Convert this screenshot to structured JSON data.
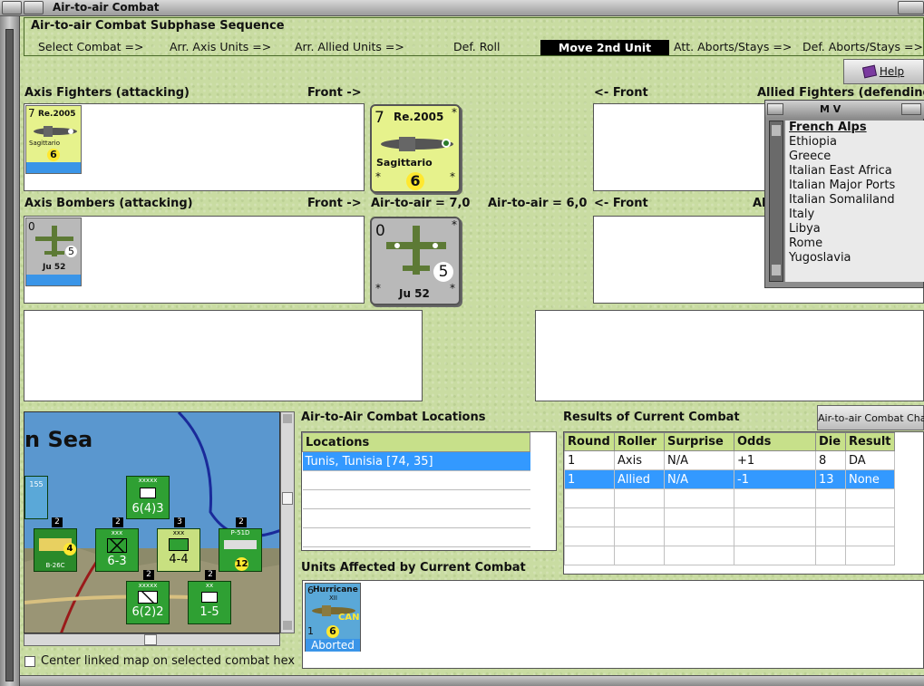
{
  "window": {
    "title": "Air-to-air Combat"
  },
  "sequence": {
    "title": "Air-to-air Combat Subphase Sequence",
    "steps": [
      "Select Combat =>",
      "Arr. Axis Units =>",
      "Arr. Allied Units =>",
      "Def. Roll",
      "Move 2nd Unit",
      "Att. Aborts/Stays =>",
      "Def. Aborts/Stays =>"
    ],
    "active": "Move 2nd Unit"
  },
  "help_label": "Help",
  "axis_fighters": {
    "header": "Axis Fighters (attacking)",
    "front": "Front ->",
    "counter": {
      "strength": "7",
      "name": "Re.2005",
      "pilot": "Sagittario",
      "value": "6",
      "star": "*"
    }
  },
  "allied_fighters": {
    "front": "<- Front",
    "header": "Allied Fighters (defending"
  },
  "axis_bombers": {
    "header": "Axis Bombers (attacking)",
    "front": "Front ->",
    "counter": {
      "strength": "0",
      "name": "Ju 52",
      "value": "5",
      "star": "*"
    }
  },
  "air_to_air": {
    "axis": "Air-to-air = 7,0",
    "allied": "Air-to-air = 6,0"
  },
  "allied_bombers": {
    "front": "<- Front",
    "header_partial": "Al"
  },
  "mv_window": {
    "title": "M V",
    "items": [
      "French Alps",
      "Ethiopia",
      "Greece",
      "Italian East Africa",
      "Italian Major Ports",
      "Italian Somaliland",
      "Italy",
      "Libya",
      "Rome",
      "Yugoslavia"
    ],
    "selected": "French Alps"
  },
  "map": {
    "sea_label": "n Sea",
    "stack_counts": [
      "2",
      "2",
      "3",
      "2",
      "2",
      "2"
    ],
    "units": [
      {
        "id": "inf1",
        "size": "xxxxx",
        "stats": "6(4)3"
      },
      {
        "id": "air1",
        "stats": "B-26C",
        "value": "4"
      },
      {
        "id": "inf2",
        "size": "xxx",
        "stats": "6-3"
      },
      {
        "id": "inf3",
        "size": "xxx",
        "stats": "4-4"
      },
      {
        "id": "air2",
        "stats": "P-51D",
        "value": "12"
      },
      {
        "id": "inf4",
        "size": "xxxxx",
        "stats": "6(2)2"
      },
      {
        "id": "mech1",
        "size": "xx",
        "stats": "1-5"
      },
      {
        "id": "edge",
        "stats": "155"
      }
    ]
  },
  "locations": {
    "header": "Air-to-Air Combat Locations",
    "column": "Locations",
    "rows": [
      "Tunis, Tunisia [74, 35]"
    ]
  },
  "results": {
    "header": "Results of Current Combat",
    "chart_button": "Air-to-air Combat Chart",
    "columns": [
      "Round",
      "Roller",
      "Surprise",
      "Odds",
      "Die",
      "Result"
    ],
    "rows": [
      [
        "1",
        "Axis",
        "N/A",
        "+1",
        "8",
        "DA"
      ],
      [
        "1",
        "Allied",
        "N/A",
        "-1",
        "13",
        "None"
      ]
    ]
  },
  "affected": {
    "header": "Units Affected by Current Combat",
    "counter": {
      "strength": "6",
      "name": "Hurricane",
      "mark": "XII",
      "nation": "CAN",
      "value": "6",
      "left": "1",
      "status": "Aborted"
    }
  },
  "center_option": "Center linked map on selected combat hex",
  "colors": {
    "panel_bg": "#c9dca2",
    "selected": "#3399ff",
    "active_step": "#000000",
    "counter_yellow": "#e6f28c"
  }
}
